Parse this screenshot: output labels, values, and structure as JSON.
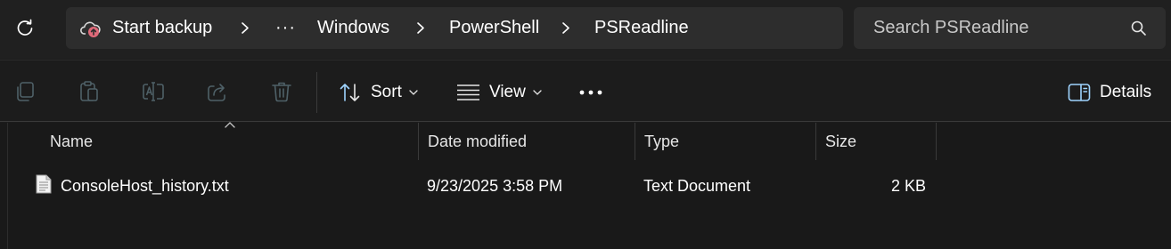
{
  "address_bar": {
    "breadcrumb": [
      {
        "label": "Start backup"
      },
      {
        "label": "..."
      },
      {
        "label": "Windows"
      },
      {
        "label": "PowerShell"
      },
      {
        "label": "PSReadline"
      }
    ],
    "more_label": "···",
    "search_placeholder": "Search PSReadline"
  },
  "command_bar": {
    "sort_label": "Sort",
    "view_label": "View",
    "details_label": "Details",
    "more_label": "···"
  },
  "file_list": {
    "columns": [
      "Name",
      "Date modified",
      "Type",
      "Size"
    ],
    "rows": [
      {
        "name": "ConsoleHost_history.txt",
        "date_modified": "9/23/2025 3:58 PM",
        "type": "Text Document",
        "size": "2 KB"
      }
    ]
  },
  "colors": {
    "background": "#1c1c1c",
    "toolbar": "#202020",
    "field": "#2d2d2d",
    "disabled_icon": "#5c6a70",
    "accent_icon": "#9fd4ff"
  },
  "icons": {
    "refresh": "refresh-icon",
    "cloud_backup": "cloud-upload-icon",
    "search": "search-icon",
    "copy": "copy-icon",
    "paste": "paste-icon",
    "rename": "rename-icon",
    "share": "share-icon",
    "delete": "delete-icon",
    "sort": "sort-icon",
    "view": "view-icon",
    "details": "details-pane-icon",
    "file": "text-file-icon"
  }
}
